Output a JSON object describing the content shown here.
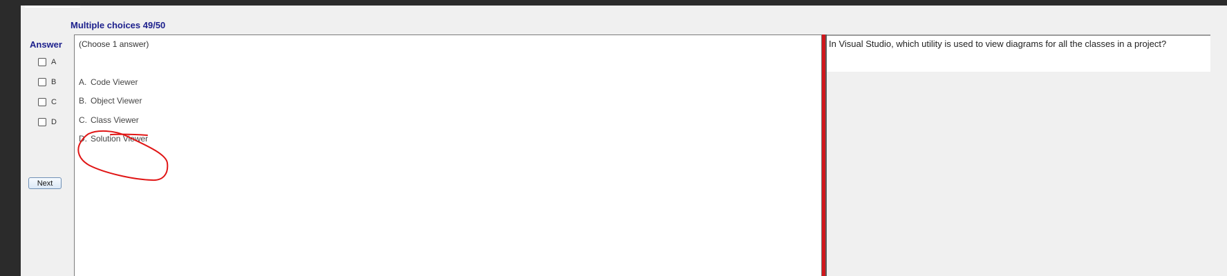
{
  "header": {
    "title": "Multiple choices 49/50"
  },
  "answer_panel": {
    "heading": "Answer",
    "options": [
      {
        "label": "A",
        "checked": false
      },
      {
        "label": "B",
        "checked": false
      },
      {
        "label": "C",
        "checked": false
      },
      {
        "label": "D",
        "checked": false
      }
    ],
    "next_label": "Next"
  },
  "choices_panel": {
    "hint": "(Choose 1 answer)",
    "choices": [
      {
        "letter": "A.",
        "text": "Code Viewer"
      },
      {
        "letter": "B.",
        "text": "Object Viewer"
      },
      {
        "letter": "C.",
        "text": "Class Viewer"
      },
      {
        "letter": "D.",
        "text": "Solution Viewer"
      }
    ]
  },
  "question_panel": {
    "text": "In Visual Studio, which utility is used to view diagrams for all the classes in a project?"
  },
  "colors": {
    "title_text": "#1b1f8c",
    "annotation_red": "#e01515",
    "splitter_red": "#d0171c"
  }
}
